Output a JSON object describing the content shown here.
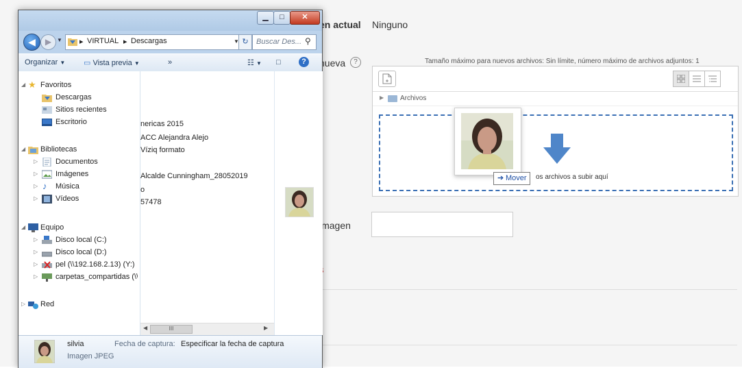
{
  "moodle": {
    "current_label": "en actual",
    "current_value": "Ninguno",
    "new_label": "nueva",
    "help_icon": "?",
    "max_info": "Tamaño máximo para nuevos archivos: Sin límite, número máximo de archivos adjuntos: 1",
    "path_folder": "Archivos",
    "drop_text": "os archivos a subir aquí",
    "desc_label": "imagen",
    "desc_value": "",
    "red_fragment": "s",
    "mover_label": "Mover",
    "colors": {
      "accent": "#3a6fb4",
      "drop_arrow": "#4f86c9"
    }
  },
  "explorer": {
    "address": {
      "seg1": "VIRTUAL",
      "seg2": "Descargas"
    },
    "search_placeholder": "Buscar Des...",
    "toolbar": {
      "organize": "Organizar",
      "preview": "Vista previa",
      "more": "»"
    },
    "nav": {
      "favorites": "Favoritos",
      "downloads": "Descargas",
      "recent": "Sitios recientes",
      "desktop": "Escritorio",
      "libraries": "Bibliotecas",
      "documents": "Documentos",
      "images": "Imágenes",
      "music": "Música",
      "videos": "Vídeos",
      "computer": "Equipo",
      "disk_c": "Disco local (C:)",
      "disk_d": "Disco local (D:)",
      "net_drive": "pel (\\\\192.168.2.13) (Y:)",
      "shared": "carpetas_compartidas (\\\\",
      "network": "Red"
    },
    "files": [
      "nericas 2015",
      "ACC Alejandra Alejo",
      "Víziq formato",
      "Alcalde Cunningham_28052019",
      "o",
      "57478"
    ],
    "details": {
      "name": "silvia",
      "type": "Imagen JPEG",
      "date_label": "Fecha de captura:",
      "date_value": "Especificar la fecha de captura"
    }
  }
}
